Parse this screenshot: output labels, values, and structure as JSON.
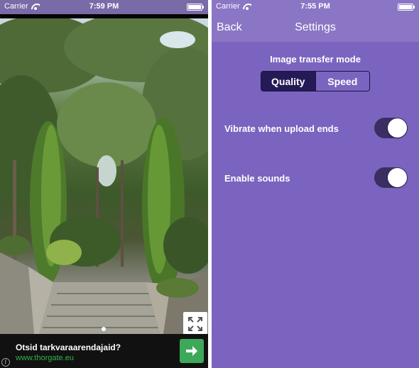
{
  "left_screen": {
    "status_bar": {
      "carrier": "Carrier",
      "time": "7:59 PM"
    },
    "ad": {
      "title": "Otsid tarkvaraarendajaid?",
      "url": "www.thorgate.eu",
      "info_label": "i"
    },
    "icons": {
      "wifi": "wifi-icon",
      "battery": "battery-icon",
      "expand": "expand-icon",
      "go": "arrow-right-icon",
      "info": "info-icon"
    }
  },
  "right_screen": {
    "status_bar": {
      "carrier": "Carrier",
      "time": "7:55 PM"
    },
    "nav": {
      "back_label": "Back",
      "title": "Settings"
    },
    "transfer_mode": {
      "label": "Image transfer mode",
      "options": [
        "Quality",
        "Speed"
      ],
      "selected": "Quality"
    },
    "settings": [
      {
        "label": "Vibrate when upload ends",
        "enabled": true
      },
      {
        "label": "Enable sounds",
        "enabled": true
      }
    ]
  },
  "colors": {
    "purple_background": "#7b64bf",
    "navbar": "#8a76c4",
    "segment_selected": "#241a55",
    "toggle_on": "#3a2e62",
    "ad_url_green": "#33b34a",
    "ad_button_green": "#3ea85a"
  }
}
